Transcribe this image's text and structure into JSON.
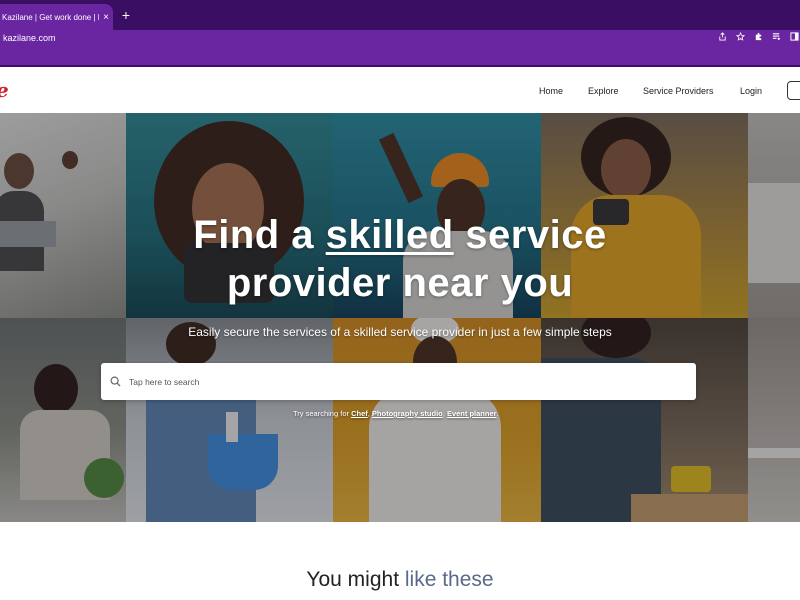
{
  "browser": {
    "tab_title": "Kazilane | Get work done | Find",
    "tab_close": "×",
    "new_tab": "+",
    "url": "kazilane.com"
  },
  "site": {
    "logo_text": "e",
    "nav": {
      "home": "Home",
      "explore": "Explore",
      "service_providers": "Service Providers",
      "login": "Login"
    }
  },
  "hero": {
    "headline_pre": "Find a ",
    "headline_underlined": "skilled",
    "headline_post": " service",
    "headline_line2": "provider near you",
    "subline": "Easily secure the services of a skilled service provider in just a few simple steps",
    "search_placeholder": "Tap here to search",
    "try_prefix": "Try searching for ",
    "suggestions": [
      "Chef",
      "Photography studio",
      "Event planner"
    ],
    "suggestion_sep": ", ",
    "try_suffix": "."
  },
  "section": {
    "title_pre": "You might ",
    "title_accent": "like these"
  },
  "colors": {
    "browser_purple": "#6a25a0",
    "browser_dark": "#3a0f63",
    "logo_red": "#d11e2b",
    "accent": "#5a6a8a"
  },
  "icons": {
    "search": "search-icon",
    "share": "share-icon",
    "star": "star-icon",
    "extensions": "puzzle-icon",
    "media": "media-control-icon",
    "sidebar": "sidebar-icon"
  }
}
